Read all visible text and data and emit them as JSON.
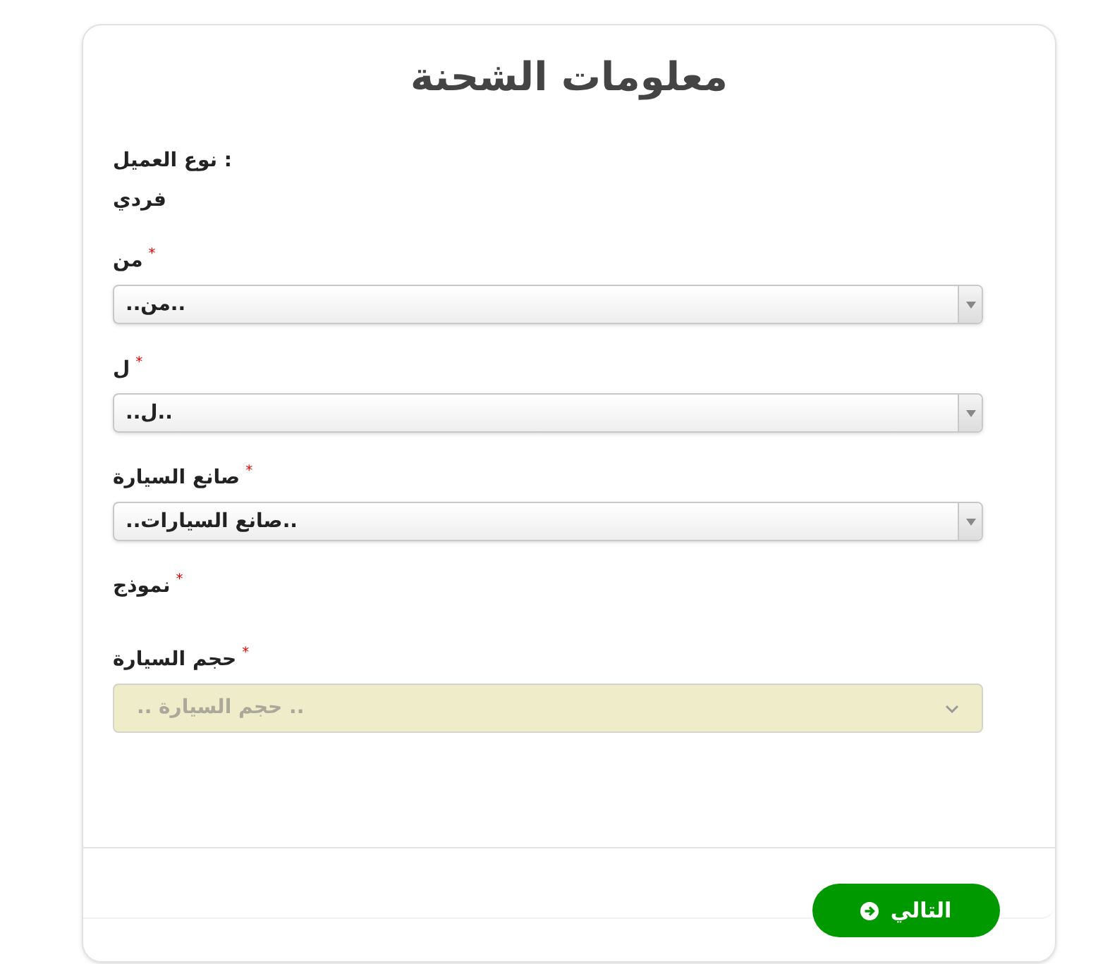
{
  "title": "معلومات الشحنة",
  "fields": [
    {
      "kind": "static",
      "label": "نوع العميل :",
      "value": "فردي"
    },
    {
      "kind": "select",
      "label": "من",
      "required_mark": "*",
      "placeholder": "..من..",
      "disabled": false
    },
    {
      "kind": "select",
      "label": "ل",
      "required_mark": "*",
      "placeholder": "..ل..",
      "disabled": false
    },
    {
      "kind": "select",
      "label": "صانع السيارة",
      "required_mark": "*",
      "placeholder": "..صانع السيارات..",
      "disabled": false
    },
    {
      "kind": "label",
      "label": "نموذج",
      "required_mark": "*"
    },
    {
      "kind": "select",
      "label": "حجم السيارة",
      "required_mark": "*",
      "placeholder": ".. حجم السيارة ..",
      "disabled": true
    }
  ],
  "next_button": {
    "label": "التالي"
  }
}
